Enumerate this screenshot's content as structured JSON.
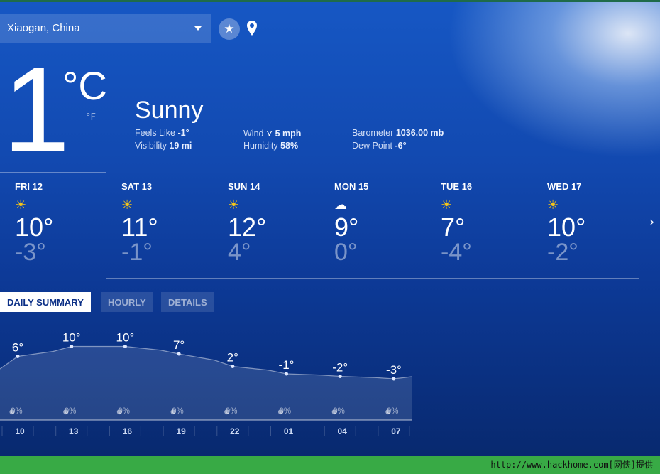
{
  "location": {
    "name": "Xiaogan, China"
  },
  "current": {
    "temp": "1",
    "unit_c": "°C",
    "unit_f": "°F",
    "condition": "Sunny",
    "feels_like_label": "Feels Like",
    "feels_like": "-1°",
    "visibility_label": "Visibility",
    "visibility": "19 mi",
    "wind_label": "Wind",
    "wind": "5 mph",
    "humidity_label": "Humidity",
    "humidity": "58%",
    "barometer_label": "Barometer",
    "barometer": "1036.00 mb",
    "dew_label": "Dew Point",
    "dew": "-6°"
  },
  "forecast": [
    {
      "day": "FRI 12",
      "icon": "sunny",
      "hi": "10°",
      "lo": "-3°"
    },
    {
      "day": "SAT 13",
      "icon": "sunny",
      "hi": "11°",
      "lo": "-1°"
    },
    {
      "day": "SUN 14",
      "icon": "sunny",
      "hi": "12°",
      "lo": "4°"
    },
    {
      "day": "MON 15",
      "icon": "cloudy",
      "hi": "9°",
      "lo": "0°"
    },
    {
      "day": "TUE 16",
      "icon": "sunny",
      "hi": "7°",
      "lo": "-4°"
    },
    {
      "day": "WED 17",
      "icon": "sunny",
      "hi": "10°",
      "lo": "-2°"
    }
  ],
  "tabs": [
    "DAILY SUMMARY",
    "HOURLY",
    "DETAILS"
  ],
  "chart_data": {
    "type": "area",
    "x": [
      "10",
      "13",
      "16",
      "19",
      "22",
      "01",
      "04",
      "07"
    ],
    "values": [
      6,
      10,
      10,
      7,
      2,
      -1,
      -2,
      -3
    ],
    "labels": [
      "6°",
      "10°",
      "10°",
      "7°",
      "2°",
      "-1°",
      "-2°",
      "-3°"
    ],
    "precip": [
      "0%",
      "0%",
      "0%",
      "0%",
      "0%",
      "0%",
      "0%",
      "0%"
    ]
  },
  "watermark": "http://www.hackhome.com[网侠]提供"
}
